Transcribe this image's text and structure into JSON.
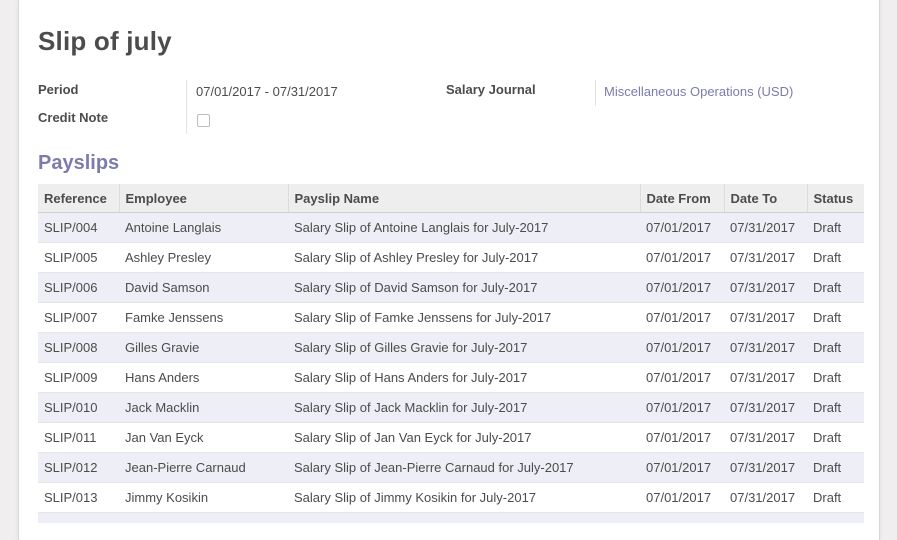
{
  "form": {
    "title": "Slip of july",
    "period_label": "Period",
    "period_value": "07/01/2017 - 07/31/2017",
    "credit_note_label": "Credit Note",
    "credit_note_checked": false,
    "journal_label": "Salary Journal",
    "journal_value": "Miscellaneous Operations (USD)"
  },
  "payslips": {
    "title": "Payslips",
    "columns": [
      "Reference",
      "Employee",
      "Payslip Name",
      "Date From",
      "Date To",
      "Status"
    ],
    "rows": [
      [
        "SLIP/004",
        "Antoine Langlais",
        "Salary Slip of Antoine Langlais for July-2017",
        "07/01/2017",
        "07/31/2017",
        "Draft"
      ],
      [
        "SLIP/005",
        "Ashley Presley",
        "Salary Slip of Ashley Presley for July-2017",
        "07/01/2017",
        "07/31/2017",
        "Draft"
      ],
      [
        "SLIP/006",
        "David Samson",
        "Salary Slip of David Samson for July-2017",
        "07/01/2017",
        "07/31/2017",
        "Draft"
      ],
      [
        "SLIP/007",
        "Famke Jenssens",
        "Salary Slip of Famke Jenssens for July-2017",
        "07/01/2017",
        "07/31/2017",
        "Draft"
      ],
      [
        "SLIP/008",
        "Gilles Gravie",
        "Salary Slip of Gilles Gravie for July-2017",
        "07/01/2017",
        "07/31/2017",
        "Draft"
      ],
      [
        "SLIP/009",
        "Hans Anders",
        "Salary Slip of Hans Anders for July-2017",
        "07/01/2017",
        "07/31/2017",
        "Draft"
      ],
      [
        "SLIP/010",
        "Jack Macklin",
        "Salary Slip of Jack Macklin for July-2017",
        "07/01/2017",
        "07/31/2017",
        "Draft"
      ],
      [
        "SLIP/011",
        "Jan Van Eyck",
        "Salary Slip of Jan Van Eyck for July-2017",
        "07/01/2017",
        "07/31/2017",
        "Draft"
      ],
      [
        "SLIP/012",
        "Jean-Pierre Carnaud",
        "Salary Slip of Jean-Pierre Carnaud for July-2017",
        "07/01/2017",
        "07/31/2017",
        "Draft"
      ],
      [
        "SLIP/013",
        "Jimmy Kosikin",
        "Salary Slip of Jimmy Kosikin for July-2017",
        "07/01/2017",
        "07/31/2017",
        "Draft"
      ]
    ]
  }
}
